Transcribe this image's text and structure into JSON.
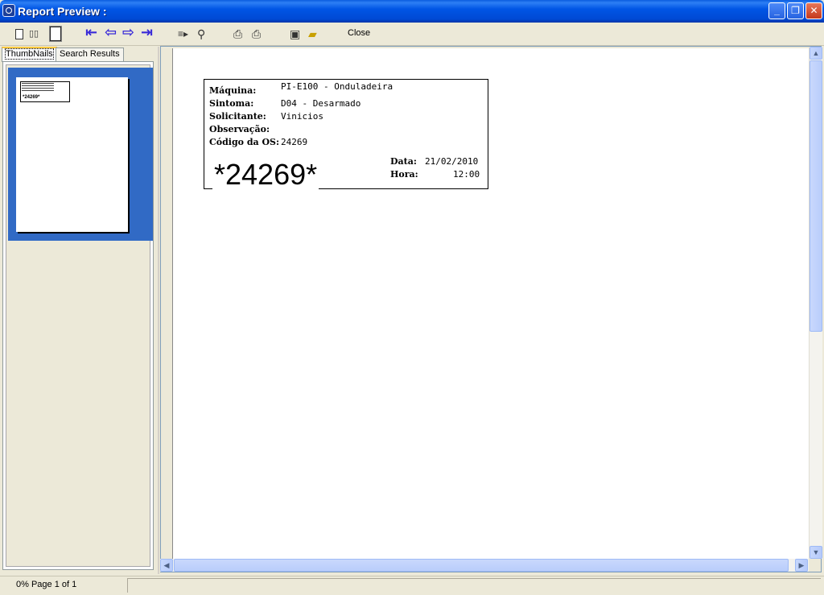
{
  "window": {
    "title": "Report Preview :"
  },
  "toolbar": {
    "close_label": "Close",
    "buttons": [
      "single-page-icon",
      "two-pages-icon",
      "whole-page-icon",
      "first-page-icon",
      "prev-page-icon",
      "next-page-icon",
      "last-page-icon",
      "goto-page-icon",
      "find-icon",
      "printer-setup-icon",
      "print-icon",
      "save-icon",
      "open-icon"
    ],
    "accent_color": "#3a2bd8"
  },
  "left_panel": {
    "tabs": [
      {
        "label": "ThumbNails",
        "active": true
      },
      {
        "label": "Search Results",
        "active": false
      }
    ],
    "thumbnail_barcode": "*24269*"
  },
  "report": {
    "fields": [
      {
        "label": "Máquina:",
        "value": "PI-E100 - Onduladeira"
      },
      {
        "label": "Sintoma:",
        "value": "D04 - Desarmado"
      },
      {
        "label": "Solicitante:",
        "value": "Vinicios"
      },
      {
        "label": "Observação:",
        "value": ""
      },
      {
        "label": "Código da OS:",
        "value": "24269"
      }
    ],
    "barcode": "*24269*",
    "date_label": "Data:",
    "date_value": "21/02/2010",
    "time_label": "Hora:",
    "time_value": "12:00"
  },
  "status": {
    "progress": "0%",
    "page_info": "Page 1 of 1"
  }
}
